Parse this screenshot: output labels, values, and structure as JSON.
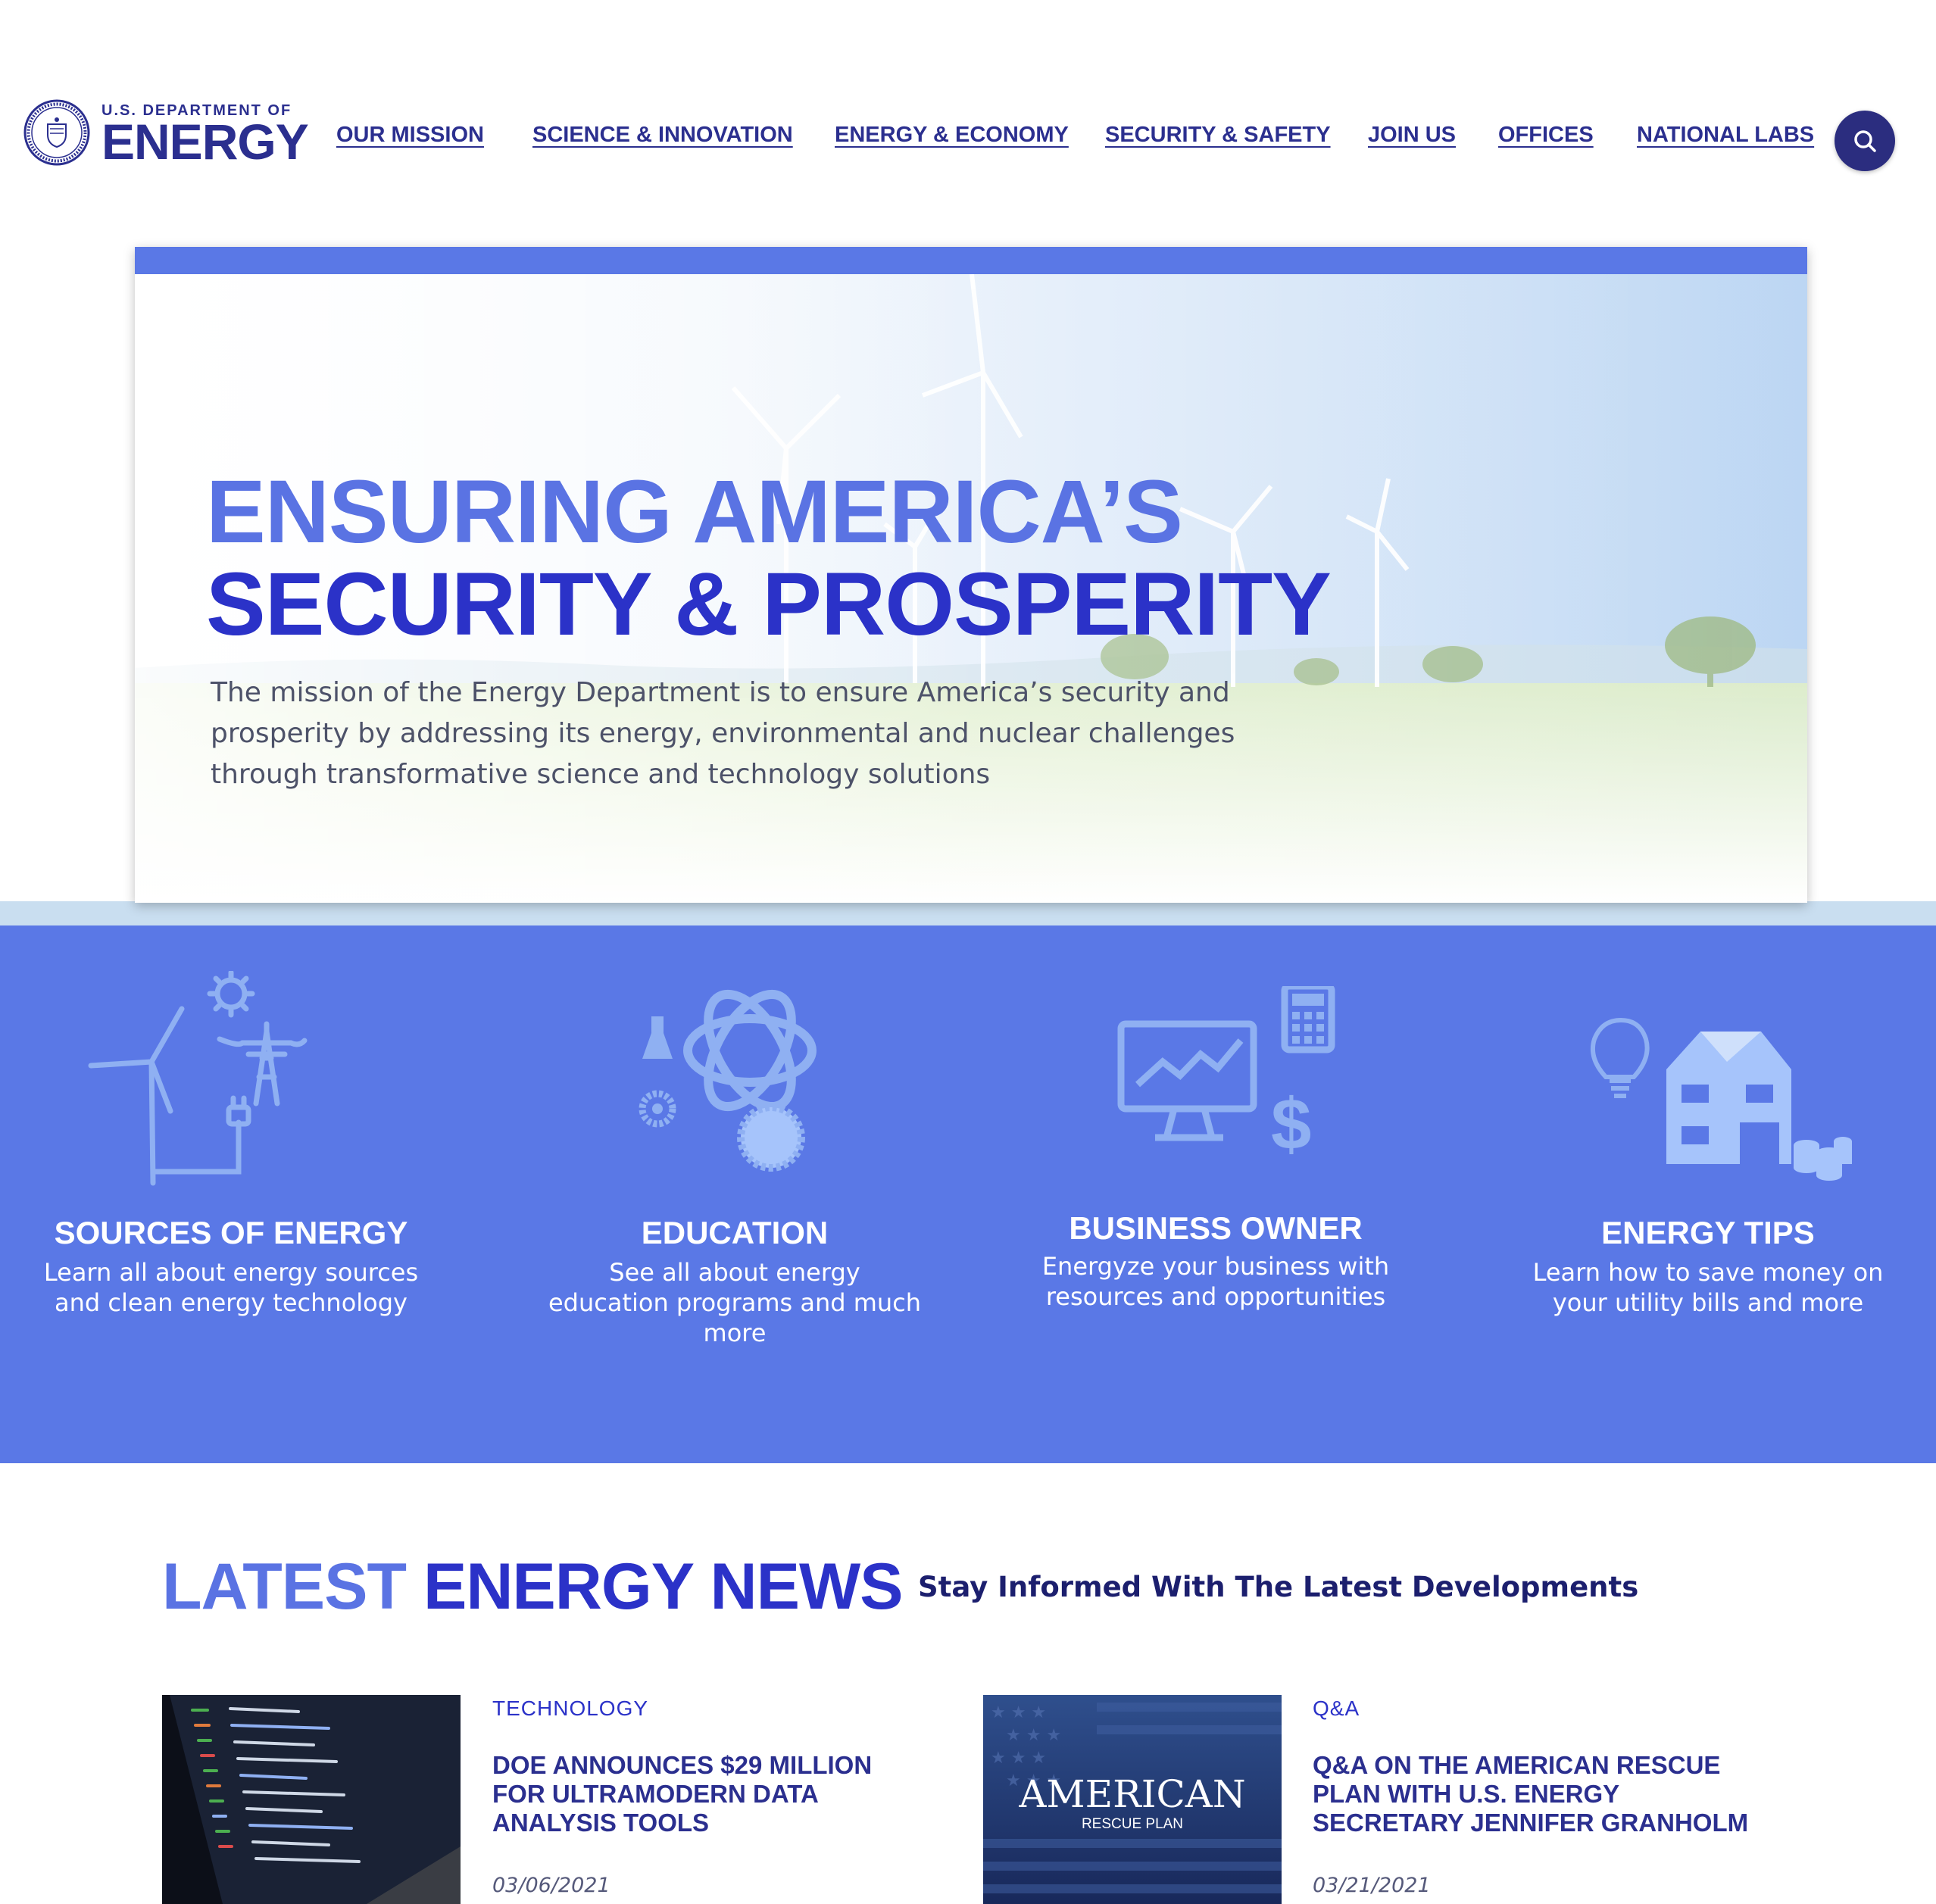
{
  "header": {
    "logo_small": "U.S. DEPARTMENT OF",
    "logo_big": "ENERGY",
    "nav": [
      {
        "label": "OUR MISSION"
      },
      {
        "label": "SCIENCE & INNOVATION"
      },
      {
        "label": "ENERGY & ECONOMY"
      },
      {
        "label": "SECURITY & SAFETY"
      },
      {
        "label": "JOIN US"
      },
      {
        "label": "OFFICES"
      },
      {
        "label": "NATIONAL LABS"
      }
    ],
    "search_icon": "search-icon"
  },
  "hero": {
    "title_line1": "ENSURING AMERICA’S",
    "title_line2": "SECURITY & PROSPERITY",
    "description": "The mission of the Energy Department is to ensure America’s security and prosperity by addressing its energy, environmental and nuclear challenges through transformative science and technology solutions"
  },
  "categories": [
    {
      "title": "SOURCES OF ENERGY",
      "description": "Learn all about energy sources and clean energy technology",
      "icon": "wind-turbine-icon"
    },
    {
      "title": "EDUCATION",
      "description": "See all about energy education programs and much more",
      "icon": "atom-icon"
    },
    {
      "title": "BUSINESS OWNER",
      "description": "Energyze your business with resources and opportunities",
      "icon": "monitor-chart-icon"
    },
    {
      "title": "ENERGY TIPS",
      "description": "Learn how to save money on your utility bills and more",
      "icon": "house-icon"
    }
  ],
  "news": {
    "heading_part1": "LATEST",
    "heading_part2": "ENERGY NEWS",
    "subheading": "Stay Informed With The Latest Developments",
    "items": [
      {
        "category": "TECHNOLOGY",
        "title": "DOE ANNOUNCES $29 MILLION FOR ULTRAMODERN DATA ANALYSIS TOOLS",
        "date": "03/06/2021",
        "image": "code-laptop-image"
      },
      {
        "category": "Q&A",
        "title": "Q&A ON THE AMERICAN RESCUE PLAN WITH U.S. ENERGY SECRETARY JENNIFER GRANHOLM",
        "date": "03/21/2021",
        "image": "american-rescue-plan-image",
        "image_text_big": "AMERICAN",
        "image_text_small": "RESCUE PLAN"
      }
    ]
  },
  "colors": {
    "navy": "#2b2f8f",
    "brand_blue": "#2b32c8",
    "light_blue": "#5a73e3",
    "panel_blue": "#5a78e6",
    "band": "#c9def0"
  }
}
